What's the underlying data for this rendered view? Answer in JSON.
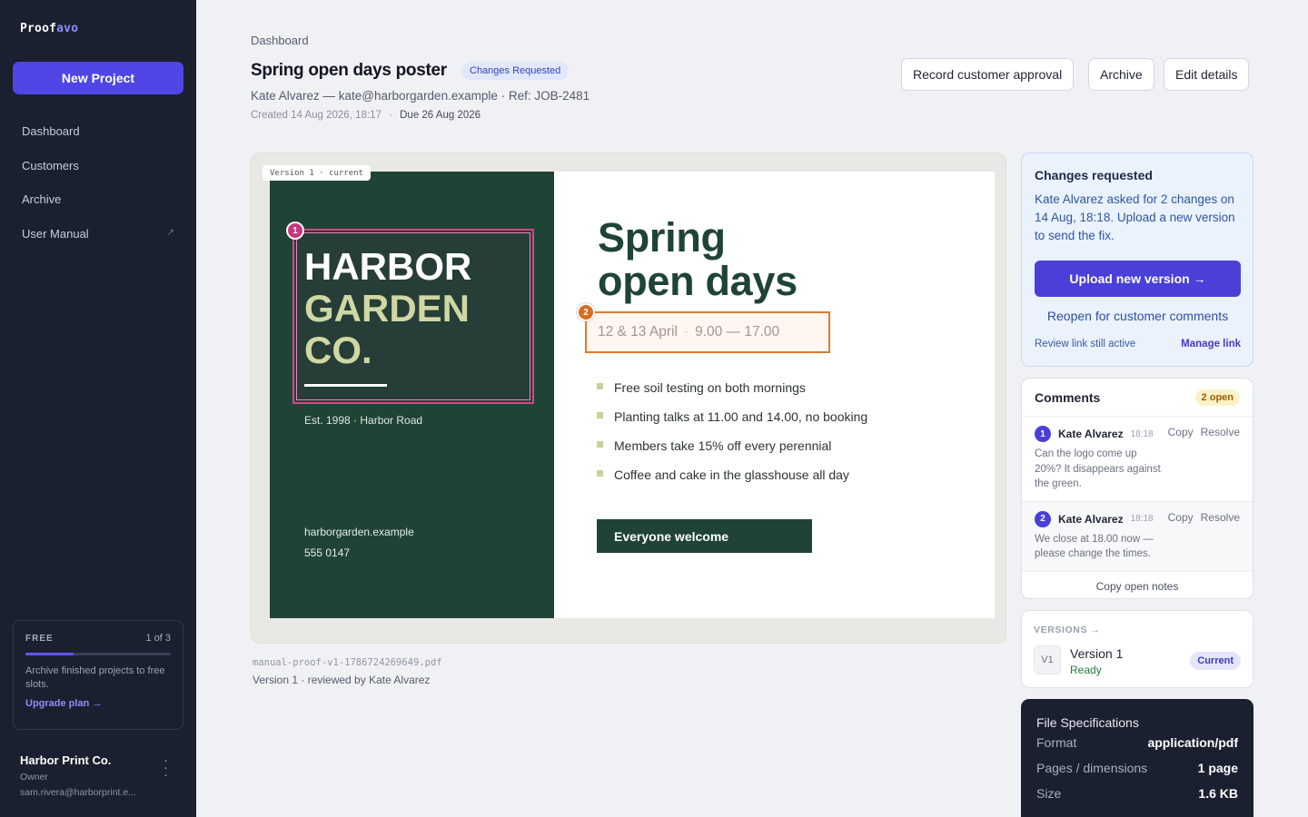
{
  "app": {
    "brand_part1": "Proof",
    "brand_part2": "avo",
    "new_project_label": "New Project"
  },
  "sidebar": {
    "items": [
      {
        "label": "Dashboard"
      },
      {
        "label": "Customers"
      },
      {
        "label": "Archive"
      },
      {
        "label": "User Manual",
        "external_icon": "external-link-icon"
      }
    ],
    "plan": {
      "label": "FREE",
      "count": "1 of 3",
      "progress": 0.33,
      "note": "Archive finished projects to free slots.",
      "upgrade_label": "Upgrade plan →"
    },
    "account": {
      "name": "Harbor Print Co.",
      "role": "Owner",
      "email": "sam.rivera@harborprint.e..."
    }
  },
  "header": {
    "breadcrumb": "Dashboard",
    "title": "Spring open days poster",
    "status": "Changes Requested",
    "customer_line": "Kate Alvarez — kate@harborgarden.example · Ref: JOB-2481",
    "created": "Created 14 Aug 2026, 18:17",
    "separator": "·",
    "due": "Due 26 Aug 2026",
    "buttons": {
      "approval": "Record customer approval",
      "archive": "Archive",
      "edit": "Edit details"
    }
  },
  "preview": {
    "version_tag": "Version 1 · current",
    "poster": {
      "brand_line1": "HARBOR",
      "brand_line2": "GARDEN",
      "brand_line3": "CO.",
      "est": "Est. 1998 · Harbor Road",
      "website": "harborgarden.example",
      "phone": "555 0147",
      "headline_line1": "Spring",
      "headline_line2": "open days",
      "dates": "12 & 13 April",
      "dates_sep": "·",
      "times": "9.00 — 17.00",
      "bullets": [
        "Free soil testing on both mornings",
        "Planting talks at 11.00 and 14.00, no booking",
        "Members take 15% off every perennial",
        "Coffee and cake in the glasshouse all day"
      ],
      "cta": "Everyone welcome"
    },
    "annotations": [
      {
        "number": "1"
      },
      {
        "number": "2"
      }
    ],
    "file_name": "manual-proof-v1-1786724269649.pdf",
    "review_note": "Version 1 · reviewed by Kate Alvarez"
  },
  "changes_card": {
    "title": "Changes requested",
    "text": "Kate Alvarez asked for 2 changes on 14 Aug, 18:18. Upload a new version to send the fix.",
    "upload_label": "Upload new version →",
    "reopen_label": "Reopen for customer comments",
    "link_status": "Review link still active",
    "manage_label": "Manage link"
  },
  "comments": {
    "title": "Comments",
    "badge": "2 open",
    "items": [
      {
        "number": "1",
        "author": "Kate Alvarez",
        "time": "18:18",
        "copy": "Copy",
        "resolve": "Resolve",
        "text": "Can the logo come up 20%? It disappears against the green."
      },
      {
        "number": "2",
        "author": "Kate Alvarez",
        "time": "18:18",
        "copy": "Copy",
        "resolve": "Resolve",
        "text": "We close at 18.00 now — please change the times."
      }
    ],
    "copy_notes_label": "Copy open notes"
  },
  "versions": {
    "label": "VERSIONS →",
    "items": [
      {
        "tile": "V1",
        "name": "Version 1",
        "status": "Ready",
        "badge": "Current"
      }
    ]
  },
  "specs": {
    "title": "File Specifications",
    "rows": [
      {
        "key": "Format",
        "value": "application/pdf"
      },
      {
        "key": "Pages / dimensions",
        "value": "1 page"
      },
      {
        "key": "Size",
        "value": "1.6 KB"
      }
    ]
  },
  "colors": {
    "accent": "#4f46e5",
    "sidebar_bg": "#1b2030",
    "poster_green": "#1f4436",
    "annotation_1": "#d6448e",
    "annotation_2": "#e07a2c"
  }
}
